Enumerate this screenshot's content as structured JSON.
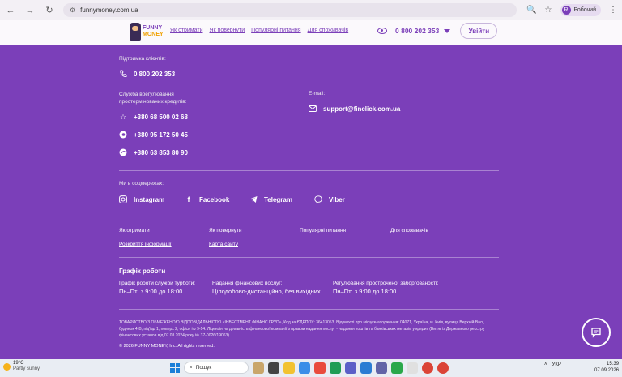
{
  "browser": {
    "url": "funnymoney.com.ua",
    "profile_initial": "R",
    "profile_label": "Робочий"
  },
  "header": {
    "logo_line1": "FUNNY",
    "logo_line2": "MONEY",
    "nav": [
      "Як отримати",
      "Як повернути",
      "Популярні питання",
      "Для споживачів"
    ],
    "phone": "0 800 202 353",
    "login_label": "Увійти"
  },
  "footer": {
    "support_label": "Підтримка клієнтів:",
    "support_phone": "0 800 202 353",
    "overdue_label_1": "Служба врегулювання",
    "overdue_label_2": "простермінованих кредитів:",
    "overdue_phones": [
      "+380 68 500 02 68",
      "+380 95 172 50 45",
      "+380 63 853 80 90"
    ],
    "email_label": "E-mail:",
    "email": "support@finclick.com.ua",
    "social_label": "Ми в соцмережах:",
    "socials": [
      "Instagram",
      "Facebook",
      "Telegram",
      "Viber"
    ],
    "links_row1": [
      "Як отримати",
      "Як повернути",
      "Популярні питання",
      "Для споживачів"
    ],
    "links_row2": [
      "Розкриття інформації",
      "Карта сайту"
    ],
    "schedule_title": "Графік роботи",
    "schedule": [
      {
        "label": "Графік роботи служби турботи:",
        "value": "Пн–Пт: з 9:00 до 18:00"
      },
      {
        "label": "Надання фінансових послуг:",
        "value": "Цілодобово-дистанційно, без вихідних"
      },
      {
        "label": "Регулювання простроченої заборгованості:",
        "value": "Пн–Пт: з 9:00 до 18:00"
      }
    ],
    "legal": "ТОВАРИСТВО З ОБМЕЖЕНОЮ ВІДПОВІДАЛЬНІСТЮ «ІНВЕСТМЕНТ ФІНАНС ГРУП», Код за ЄДРПОУ: 36413053. Відомості про місцезнаходження: 04071, Україна, м. Київ, вулиця Верхній Вал, будинок 4-В, під'їзд 1, поверх 2, офіси № 9-14. Ліцензія на діяльність фінансової компанії з правом надання послуг - надання коштів та банківських металів у кредит (Витяг із Державного реєстру фінансових установ від 07.03.2024 року № 37-0026/19063).",
    "copyright": "© 2026 FUNNY MONEY, Inc. All rights reserved."
  },
  "taskbar": {
    "weather_temp": "19°C",
    "weather_desc": "Partly sunny",
    "search": "Пошук",
    "lang": "УКР",
    "time": "15:39",
    "date": "07.09.2026"
  }
}
